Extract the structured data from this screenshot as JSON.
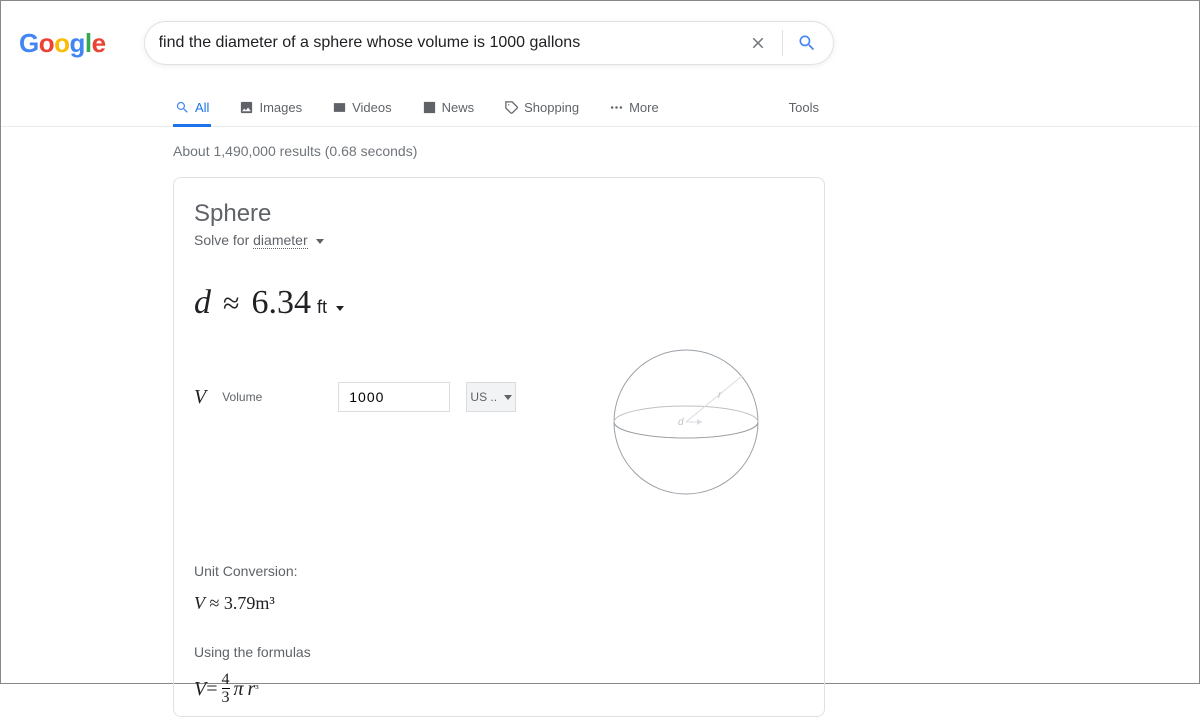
{
  "search": {
    "query": "find the diameter of a sphere whose volume is 1000 gallons"
  },
  "tabs": {
    "all": "All",
    "images": "Images",
    "videos": "Videos",
    "news": "News",
    "shopping": "Shopping",
    "more": "More",
    "tools": "Tools"
  },
  "results_stats": "About 1,490,000 results (0.68 seconds)",
  "card": {
    "title": "Sphere",
    "solve_for_label": "Solve for",
    "solve_for_target": "diameter",
    "result_symbol": "d",
    "result_approx": "≈",
    "result_value": "6.34",
    "result_unit": "ft",
    "volume_symbol": "V",
    "volume_label": "Volume",
    "volume_value": "1000",
    "volume_unit": "US ..",
    "unit_conv_label": "Unit Conversion:",
    "unit_conv_eq_v": "V",
    "unit_conv_eq_rest": "≈ 3.79m³",
    "formulas_label": "Using the formulas",
    "formula_v": "V",
    "formula_eq": "=",
    "formula_frac_num": "4",
    "formula_frac_den": "3",
    "formula_pi": "π",
    "formula_r": "r",
    "formula_exp": "³",
    "diagram_r_label": "r",
    "diagram_d_label": "d"
  }
}
